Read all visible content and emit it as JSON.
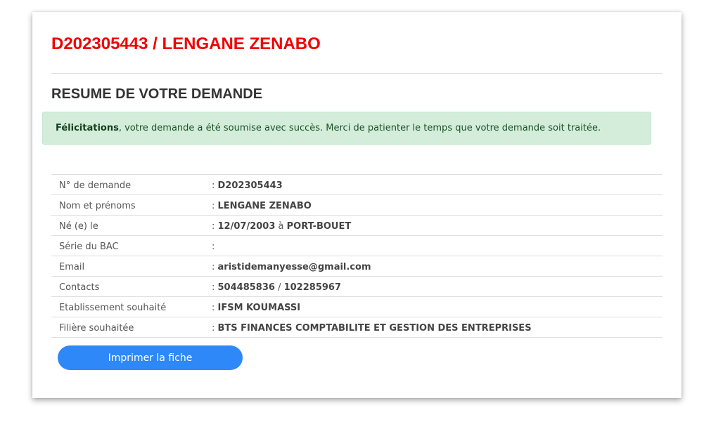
{
  "header": {
    "title": "D202305443 / LENGANE ZENABO",
    "subtitle": "RESUME DE VOTRE DEMANDE"
  },
  "alert": {
    "strong": "Félicitations",
    "message": ", votre demande a été soumise avec succès. Merci de patienter le temps que votre demande soit traitée."
  },
  "details": {
    "separator": ": ",
    "rows": [
      {
        "label": "N° de demande",
        "value": "D202305443"
      },
      {
        "label": "Nom et prénoms",
        "value": "LENGANE ZENABO"
      },
      {
        "label": "Né (e) le",
        "value_a": "12/07/2003",
        "connector": " à ",
        "value_b": "PORT-BOUET"
      },
      {
        "label": "Série du BAC",
        "value": ""
      },
      {
        "label": "Email",
        "value": "aristidemanyesse@gmail.com"
      },
      {
        "label": "Contacts",
        "value_a": "504485836",
        "connector": " / ",
        "value_b": "102285967"
      },
      {
        "label": "Etablissement souhaité",
        "value": "IFSM KOUMASSI"
      },
      {
        "label": "Filière souhaitée",
        "value": "BTS FINANCES COMPTABILITE ET GESTION DES ENTREPRISES"
      }
    ]
  },
  "actions": {
    "print_label": "Imprimer la fiche"
  },
  "colors": {
    "title_red": "#f00000",
    "alert_bg": "#d4edda",
    "button_blue": "#2e88f7"
  }
}
